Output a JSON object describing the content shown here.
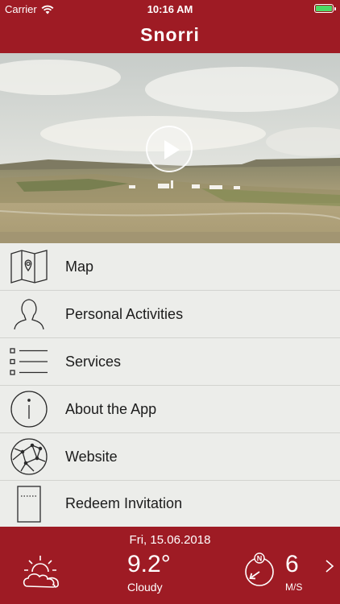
{
  "status": {
    "carrier": "Carrier",
    "time": "10:16 AM",
    "battery_level": 1.0
  },
  "header": {
    "title": "Snorri"
  },
  "hero": {
    "play_icon": "play-icon"
  },
  "menu": {
    "items": [
      {
        "label": "Map",
        "icon": "map-icon"
      },
      {
        "label": "Personal Activities",
        "icon": "person-icon"
      },
      {
        "label": "Services",
        "icon": "list-icon"
      },
      {
        "label": "About the App",
        "icon": "info-icon"
      },
      {
        "label": "Website",
        "icon": "globe-icon"
      },
      {
        "label": "Redeem Invitation",
        "icon": "ticket-icon"
      }
    ]
  },
  "weather": {
    "date": "Fri, 15.06.2018",
    "temperature": "9.2°",
    "condition": "Cloudy",
    "wind_speed": "6",
    "wind_unit": "M/S",
    "compass_label": "N",
    "wind_direction_deg": 235
  },
  "colors": {
    "brand_red": "#9e1b24",
    "menu_bg": "#ecedea",
    "battery_green": "#4cd964"
  }
}
